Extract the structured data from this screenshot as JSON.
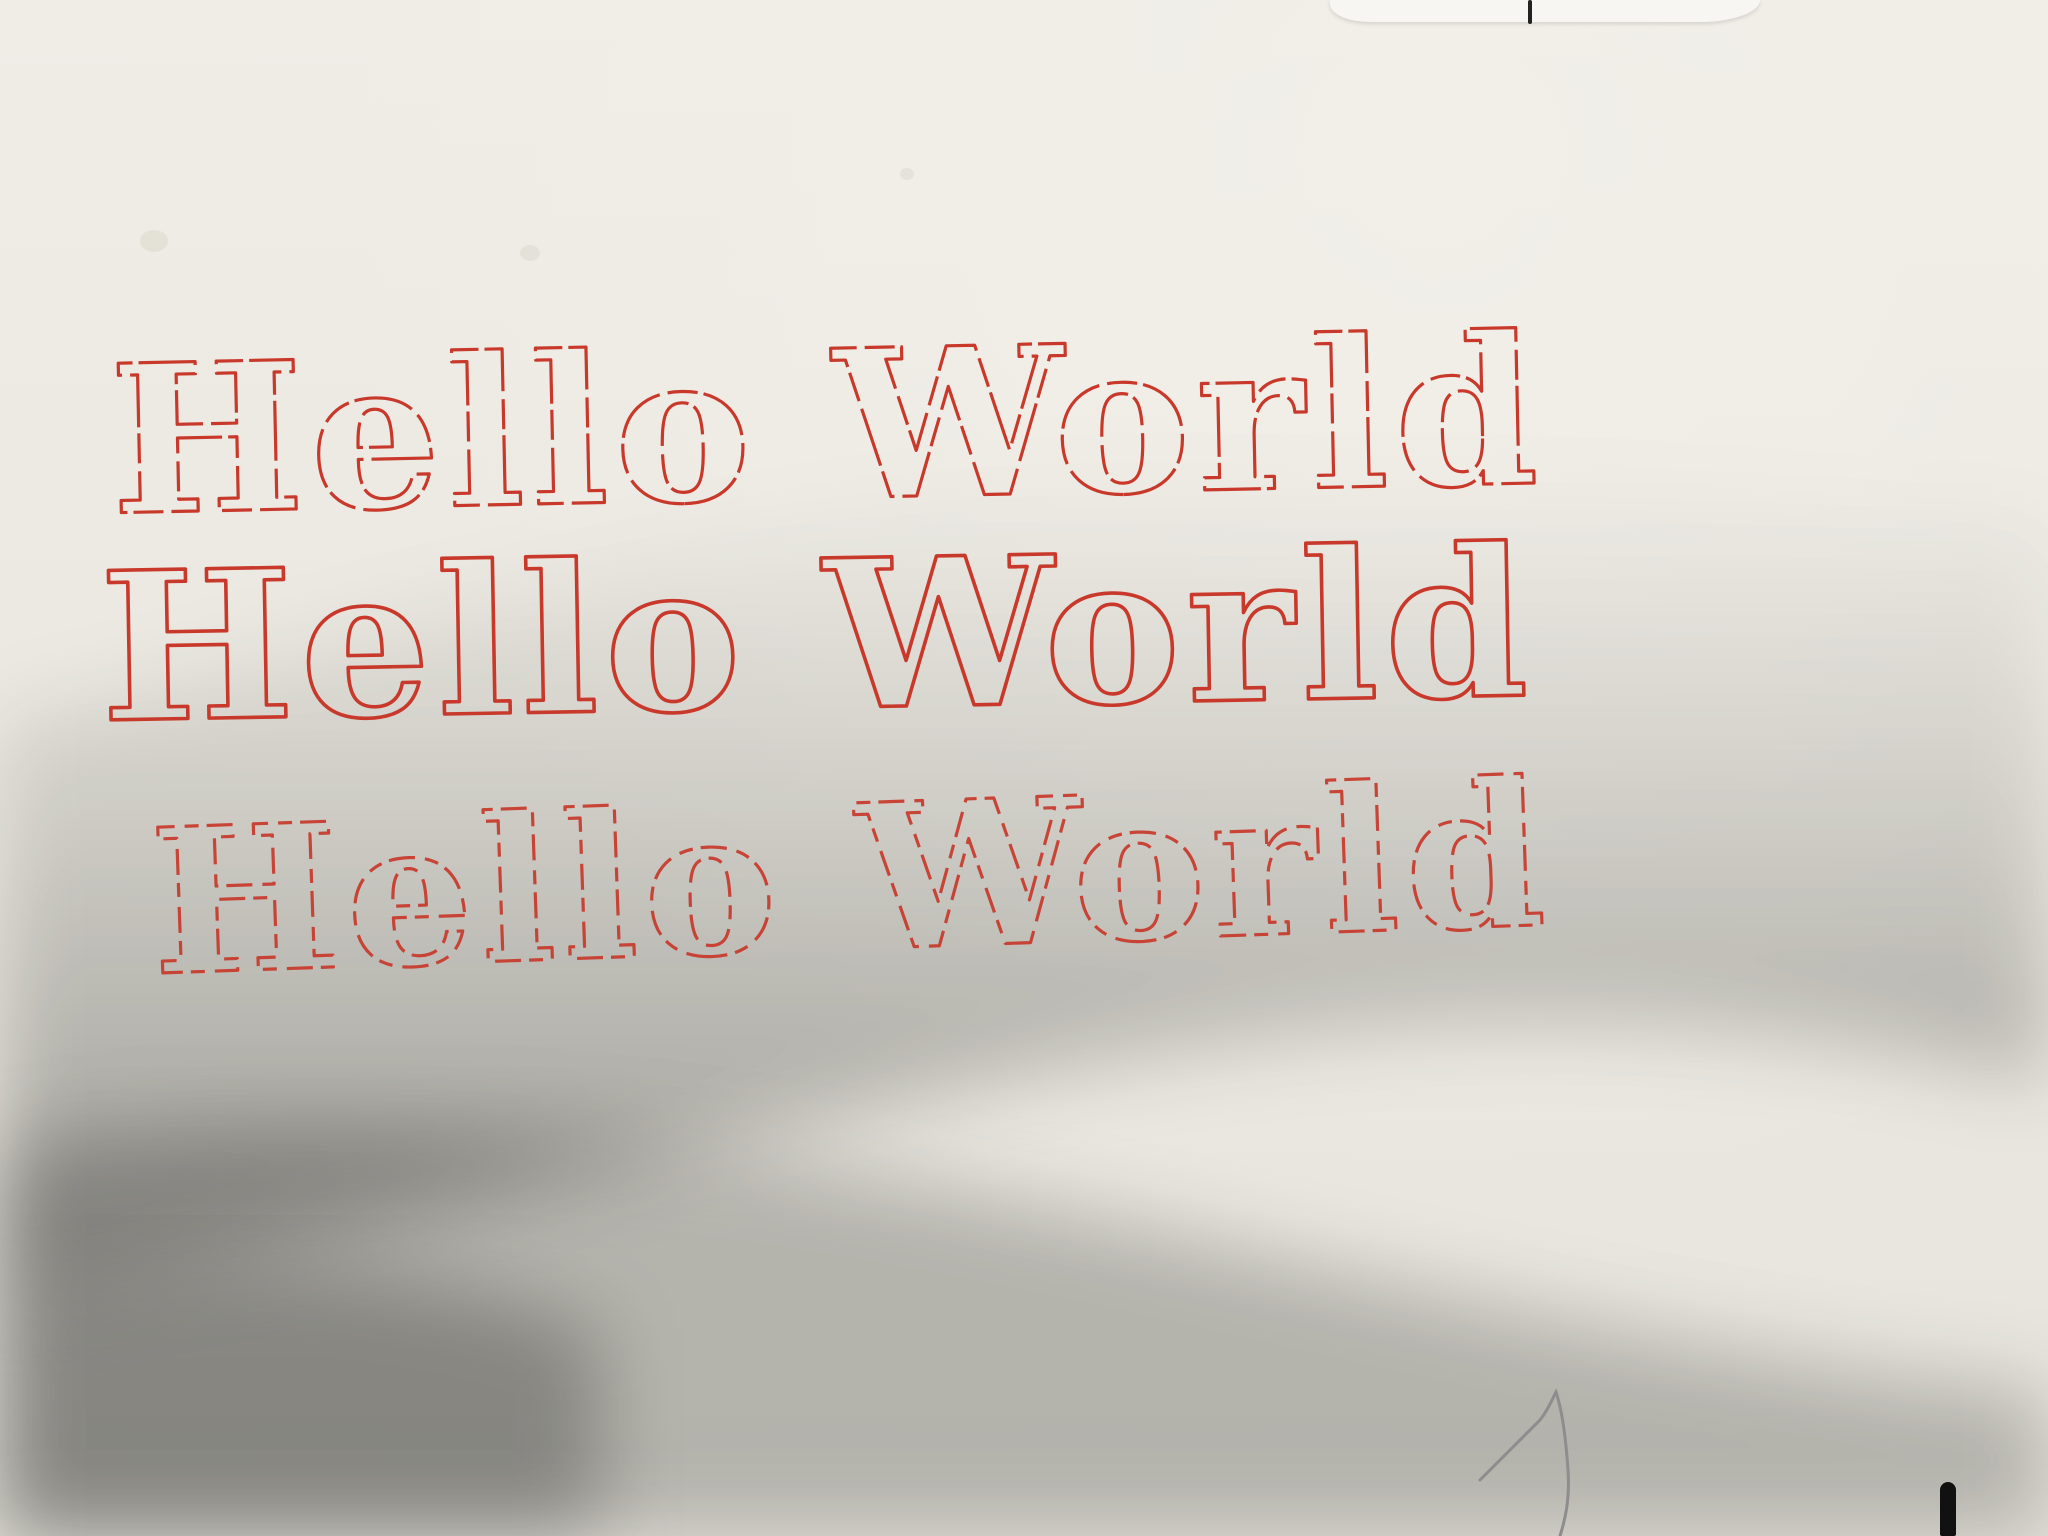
{
  "photo": {
    "plotted_lines": [
      {
        "text": "Hello World",
        "rendering": "outline, slightly broken strokes"
      },
      {
        "text": "Hello World",
        "rendering": "outline, solid strokes"
      },
      {
        "text": "Hello World",
        "rendering": "outline, heavily dashed / faded strokes"
      }
    ],
    "ink_color": "#c8392b",
    "paper_color": "#ebe9e1"
  }
}
